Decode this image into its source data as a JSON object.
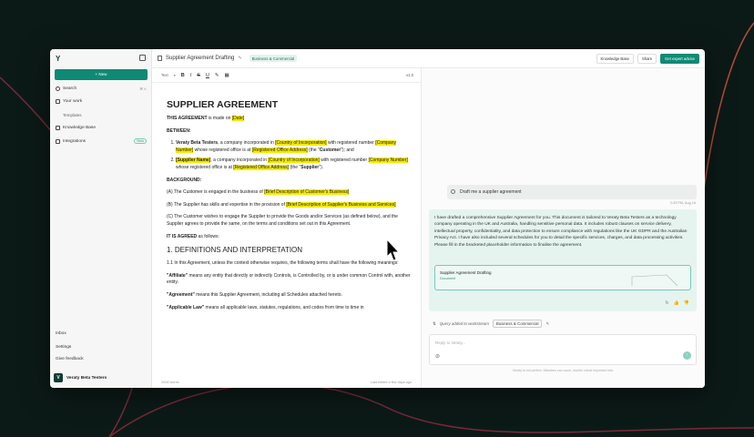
{
  "sidebar": {
    "new_label": "+ New",
    "search_label": "Search",
    "search_kbd": "⌘ K",
    "your_work_label": "Your work",
    "templates_label": "Templates",
    "knowledge_base_label": "Knowledge Base",
    "integrations_label": "Integrations",
    "integrations_badge": "New",
    "inbox_label": "Inbox",
    "settings_label": "Settings",
    "feedback_label": "Give feedback",
    "org_name": "Veraty Beta Testers",
    "org_initial": "V"
  },
  "topbar": {
    "doc_title": "Supplier Agreement Drafting",
    "tag": "Business & Commercial",
    "knowledge_base_btn": "Knowledge Base",
    "share_btn": "Share",
    "expert_btn": "Get expert advice"
  },
  "toolbar": {
    "text_style": "Text",
    "bold": "B",
    "italic": "I",
    "strike": "S",
    "underline": "U",
    "version": "v1.0"
  },
  "doc": {
    "title": "SUPPLIER AGREEMENT",
    "intro_a": "THIS AGREEMENT",
    "intro_b": " is made on ",
    "date": "[Date]",
    "between": "BETWEEN:",
    "p1_name": "Veraty Beta Testers",
    "p1_a": ", a company incorporated in ",
    "p1_country": "[Country of Incorporation]",
    "p1_b": " with registered number ",
    "p1_number": "[Company Number]",
    "p1_c": " whose registered office is at ",
    "p1_address": "[Registered Office Address]",
    "p1_d": " (the \"",
    "p1_role": "Customer",
    "p1_e": "\"); and",
    "p2_name": "[Supplier Name]",
    "p2_a": ", a company incorporated in ",
    "p2_country": "[Country of Incorporation]",
    "p2_b": " with registered number ",
    "p2_number": "[Company Number]",
    "p2_c": " whose registered office is at ",
    "p2_address": "[Registered Office Address]",
    "p2_d": " (the \"",
    "p2_role": "Supplier",
    "p2_e": "\").",
    "background": "BACKGROUND:",
    "a_text": "(A) The Customer is engaged in the business of ",
    "a_hl": "[Brief Description of Customer's Business]",
    "b_text": "(B) The Supplier has skills and expertise in the provision of ",
    "b_hl": "[Brief Description of Supplier's Business and Services]",
    "c_text": "(C) The Customer wishes to engage the Supplier to provide the Goods and/or Services (as defined below), and the Supplier agrees to provide the same, on the terms and conditions set out in this Agreement.",
    "agreed_a": "IT IS AGREED",
    "agreed_b": " as follows:",
    "section1": "1. DEFINITIONS AND INTERPRETATION",
    "s11": "1.1 In this Agreement, unless the context otherwise requires, the following terms shall have the following meanings:",
    "def1_term": "\"Affiliate\"",
    "def1_text": " means any entity that directly or indirectly Controls, is Controlled by, or is under common Control with, another entity.",
    "def2_term": "\"Agreement\"",
    "def2_text": " means this Supplier Agreement, including all Schedules attached hereto.",
    "def3_term": "\"Applicable Law\"",
    "def3_text": " means all applicable laws, statutes, regulations, and codes from time to time in"
  },
  "editor_footer": {
    "left": "2008 words",
    "right": "Last edited a few days ago"
  },
  "chat": {
    "user_msg": "Draft me a supplier agreement",
    "time": "2:33 PM, Aug 16",
    "ai_msg": "I have drafted a comprehensive Supplier Agreement for you. This document is tailored to Veraty Beta Testers as a technology company operating in the UK and Australia, handling sensitive personal data. It includes robust clauses on service delivery, intellectual property, confidentiality, and data protection to ensure compliance with regulations like the UK GDPR and the Australian Privacy Act. I have also included several schedules for you to detail the specific services, charges, and data processing activities. Please fill in the bracketed placeholder information to finalise the agreement.",
    "card_title": "Supplier Agreement Drafting",
    "card_sub": "Document",
    "query_label": "Query added to workstream",
    "query_tag": "Business & Commercial",
    "input_placeholder": "Reply to Veraty...",
    "disclaimer": "Veraty is not perfect. Mistakes can occur, double check important info."
  },
  "colors": {
    "accent": "#0e8a74",
    "highlight": "#f5ea00",
    "background": "#0c1a17"
  }
}
